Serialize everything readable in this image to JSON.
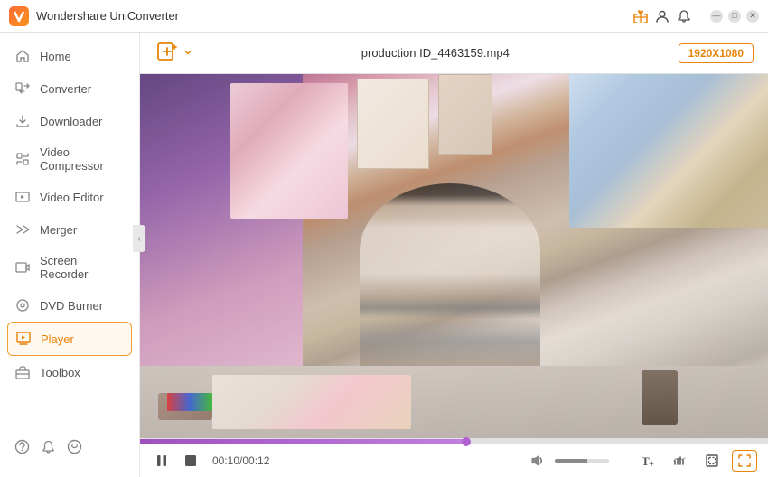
{
  "app": {
    "title": "Wondershare UniConverter",
    "logo_letter": "W"
  },
  "titlebar": {
    "icons": [
      "gift-icon",
      "user-icon",
      "notification-icon"
    ],
    "minimize_label": "—",
    "maximize_label": "□",
    "close_label": "✕"
  },
  "sidebar": {
    "items": [
      {
        "id": "home",
        "label": "Home",
        "icon": "home-icon"
      },
      {
        "id": "converter",
        "label": "Converter",
        "icon": "converter-icon"
      },
      {
        "id": "downloader",
        "label": "Downloader",
        "icon": "downloader-icon"
      },
      {
        "id": "video-compressor",
        "label": "Video Compressor",
        "icon": "compress-icon"
      },
      {
        "id": "video-editor",
        "label": "Video Editor",
        "icon": "editor-icon"
      },
      {
        "id": "merger",
        "label": "Merger",
        "icon": "merger-icon"
      },
      {
        "id": "screen-recorder",
        "label": "Screen Recorder",
        "icon": "recorder-icon"
      },
      {
        "id": "dvd-burner",
        "label": "DVD Burner",
        "icon": "dvd-icon"
      },
      {
        "id": "player",
        "label": "Player",
        "icon": "player-icon",
        "active": true
      },
      {
        "id": "toolbox",
        "label": "Toolbox",
        "icon": "toolbox-icon"
      }
    ],
    "bottom_icons": [
      "help-icon",
      "bell-icon",
      "feedback-icon"
    ]
  },
  "toolbar": {
    "add_btn_label": "",
    "file_name": "production ID_4463159.mp4",
    "resolution": "1920X1080"
  },
  "player": {
    "current_time": "00:10/00:12",
    "progress_percent": 52,
    "volume_percent": 60,
    "controls": {
      "play_pause": "pause",
      "stop": "stop",
      "subtitle_btn": "T↓",
      "audio_btn": "♫",
      "crop_btn": "⊞",
      "fullscreen_btn": "⛶"
    }
  }
}
